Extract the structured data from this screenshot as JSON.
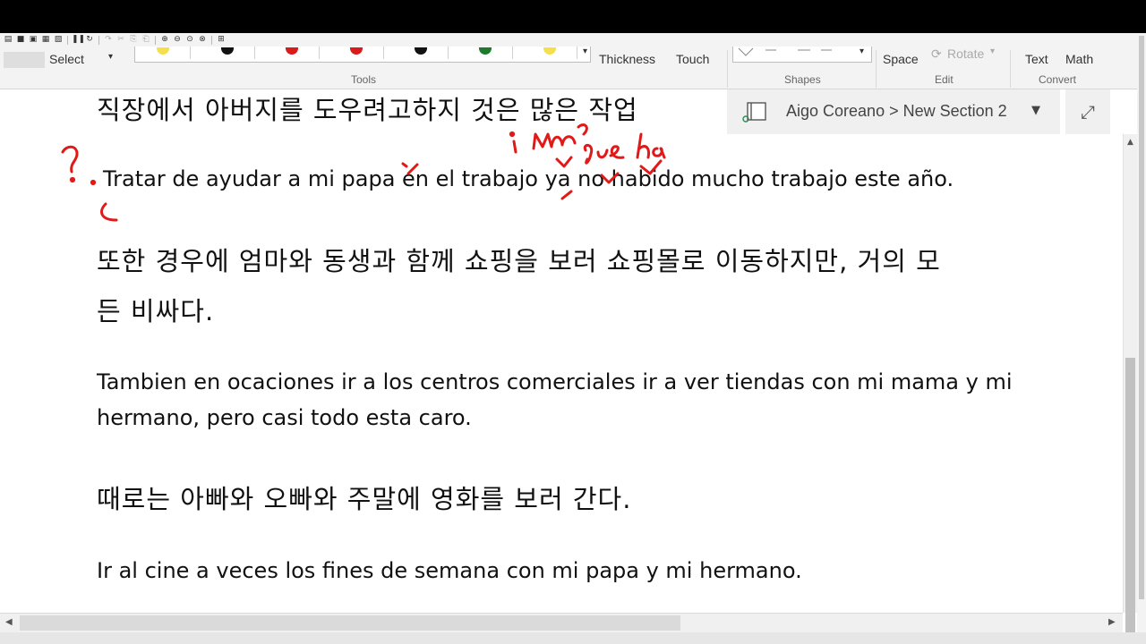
{
  "qat": {
    "icons": [
      "new-page-icon",
      "save-icon",
      "print-icon",
      "page-setup-icon",
      "pause-icon",
      "sync-icon",
      "redo-icon",
      "cut-icon",
      "copy-icon",
      "paste-icon",
      "zoom-in-icon",
      "zoom-out-icon",
      "zoom-reset-icon",
      "zoom-fit-icon",
      "snapshot-icon"
    ]
  },
  "ribbon": {
    "select_label": "Select",
    "thickness_label": "Thickness",
    "touch_label": "Touch",
    "tools_group": "Tools",
    "shapes_group": "Shapes",
    "space_label": "Space",
    "rotate_label": "Rotate",
    "edit_group": "Edit",
    "text_label": "Text",
    "math_label": "Math",
    "convert_group": "Convert",
    "pen_colors": [
      "#f4e04d",
      "#111111",
      "#d81b1b",
      "#d81b1b",
      "#111111",
      "#1f7a2e",
      "#f4e04d"
    ]
  },
  "notebook": {
    "breadcrumb": "Aigo Coreano > New Section 2"
  },
  "note": {
    "lines": [
      "직장에서 아버지를 도우려고하지 것은 많은 작업",
      "Tratar de ayudar a mi papa en el trabajo ya  no habido mucho trabajo este año.",
      "또한 경우에 엄마와 동생과 함께 쇼핑을 보러 쇼핑몰로 이동하지만, 거의 모",
      "든 비싸다.",
      " Tambien en ocaciones ir a los centros comerciales ir a ver tiendas con mi mama y mi",
      "hermano, pero casi todo esta caro.",
      "때로는 아빠와 오빠와 주말에 영화를 보러 간다.",
      " Ir al cine a  veces los fines de semana con mi papa y mi hermano."
    ]
  }
}
